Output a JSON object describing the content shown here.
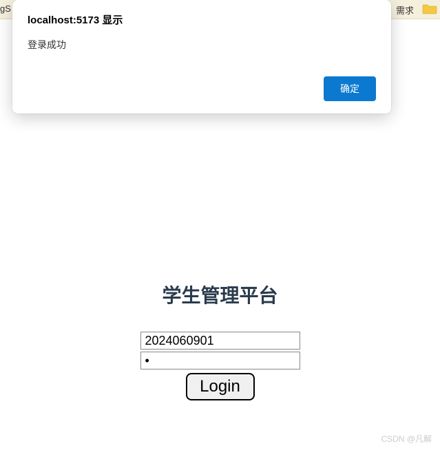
{
  "toolbar": {
    "left_fragment": "gS",
    "right_fragment": "需求"
  },
  "alert": {
    "title": "localhost:5173 显示",
    "message": "登录成功",
    "ok_label": "确定"
  },
  "login": {
    "title": "学生管理平台",
    "username_value": "2024060901",
    "password_value": "•",
    "button_label": "Login"
  },
  "watermark": "CSDN @凡解"
}
